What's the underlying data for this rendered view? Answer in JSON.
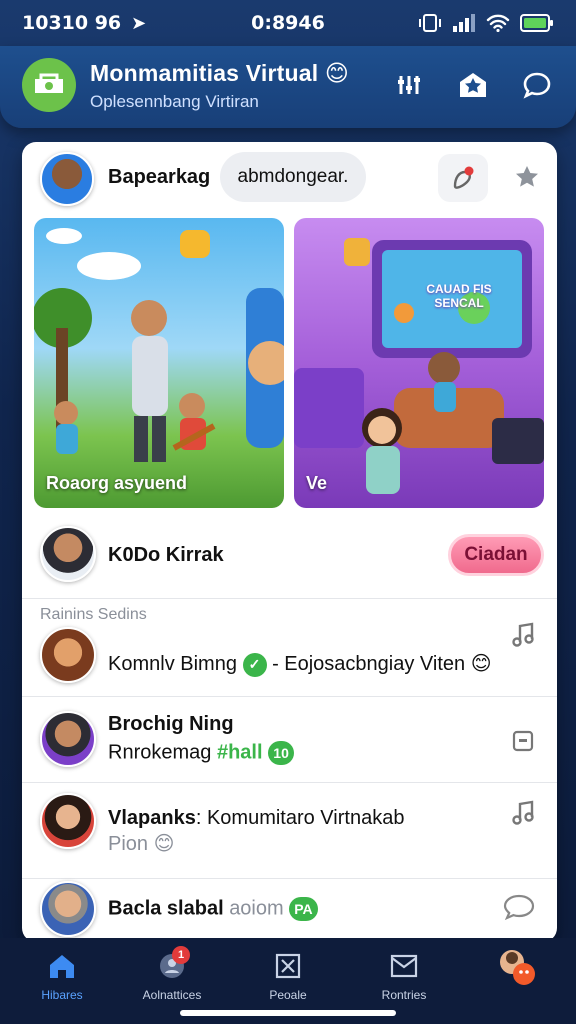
{
  "status": {
    "time": "10310 96",
    "center": "0:8946"
  },
  "header": {
    "title": "Monmamitias Virtual",
    "subtitle": "Oplesennbang Virtiran",
    "title_emoji": "😊"
  },
  "profile": {
    "name": "Bapearkag",
    "pill": "abmdongear."
  },
  "tiles": [
    {
      "label": "Roaorg asyuend"
    },
    {
      "label": "Ve",
      "screen_text": "CAUAD FIS SENCAL"
    }
  ],
  "contact": {
    "name": "K0Do Kirrak",
    "cta": "Ciadan"
  },
  "section": {
    "label": "Rainins Sedins"
  },
  "messages": [
    {
      "title": "",
      "text": "Komnlv Bimng",
      "badge": "",
      "text2": "- Eojosacbngiay Viten",
      "emoji": "😊",
      "icon": "music-note"
    },
    {
      "title": "Brochig Ning",
      "text": "Rnrokemag",
      "green": "#hall",
      "badge": "10",
      "icon": "stop"
    },
    {
      "title": "Vlapanks",
      "text": ": Komumitaro Virtnakab",
      "sub": "Pion",
      "emoji": "😊",
      "icon": "music-note"
    },
    {
      "title": "",
      "text": "Bacla slabal",
      "text2": "aoiom",
      "badge": "PA",
      "icon": "chat-bubble"
    }
  ],
  "nav": [
    {
      "label": "Hibares",
      "icon": "home-icon",
      "active": true
    },
    {
      "label": "Aolnattices",
      "icon": "people-icon",
      "badge": "1"
    },
    {
      "label": "Peoale",
      "icon": "box-x-icon"
    },
    {
      "label": "Rontries",
      "icon": "inbox-icon"
    },
    {
      "label": "",
      "icon": "avatar-icon"
    }
  ],
  "colors": {
    "accent": "#1e4f8e",
    "cta": "#f06a8d",
    "badge": "#3bb54a"
  }
}
